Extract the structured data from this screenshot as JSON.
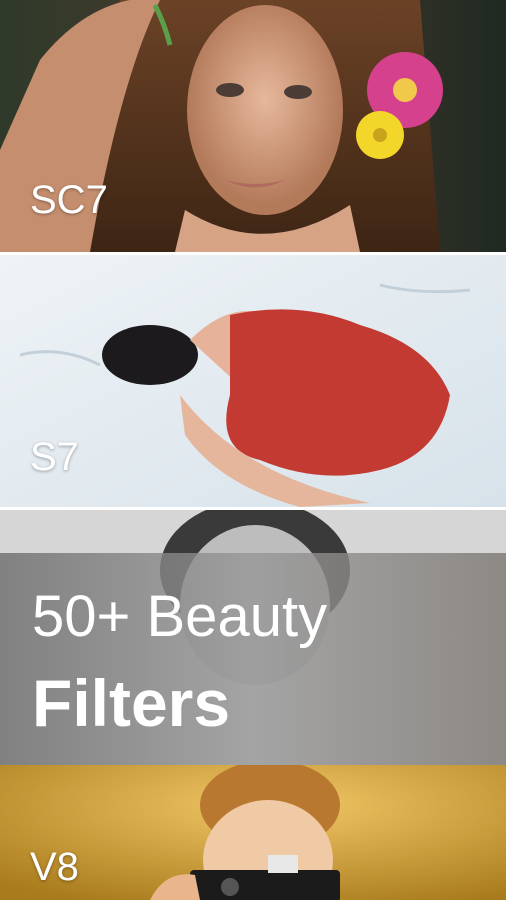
{
  "filters": [
    {
      "label": "SC7"
    },
    {
      "label": "S7"
    },
    {
      "label": "V8"
    }
  ],
  "promo": {
    "line1": "50+ Beauty",
    "line2": "Filters"
  }
}
